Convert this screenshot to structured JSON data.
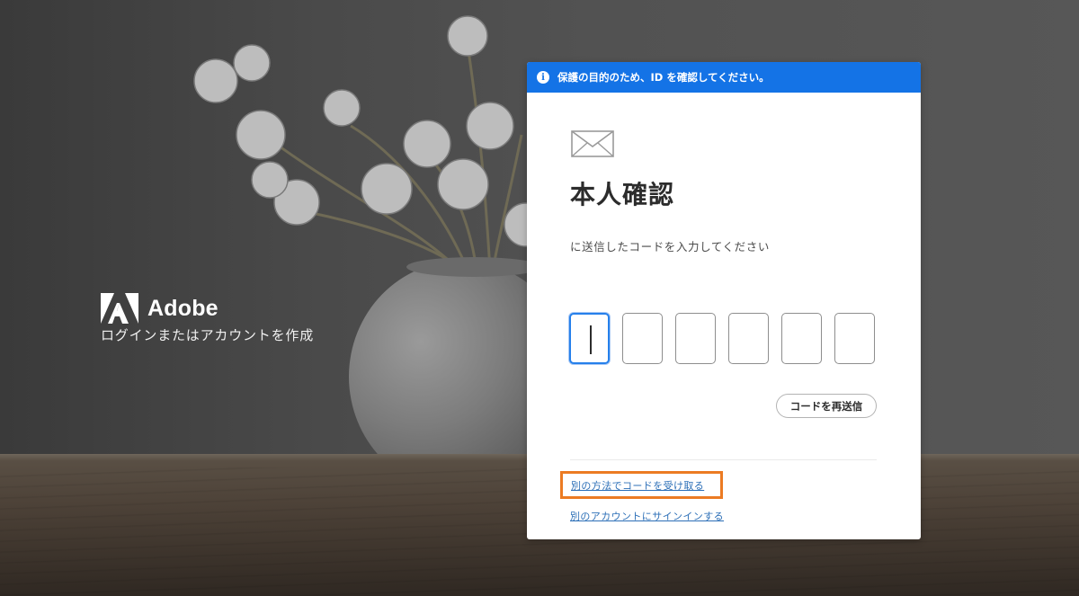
{
  "brand": {
    "name": "Adobe",
    "subtitle": "ログインまたはアカウントを作成"
  },
  "dialog": {
    "banner_text": "保護の目的のため、ID を確認してください。",
    "banner_icon": "info-icon",
    "envelope_icon": "mail-icon",
    "title": "本人確認",
    "description": "に送信したコードを入力してください",
    "code_digits": [
      "",
      "",
      "",
      "",
      "",
      ""
    ],
    "active_digit_index": 0,
    "resend_label": "コードを再送信",
    "alt_method_link": "別の方法でコードを受け取る",
    "other_account_link": "別のアカウントにサインインする"
  },
  "colors": {
    "banner": "#1473e6",
    "link": "#2c6fb7",
    "highlight": "#ec7b23",
    "active_border": "#2680eb"
  }
}
